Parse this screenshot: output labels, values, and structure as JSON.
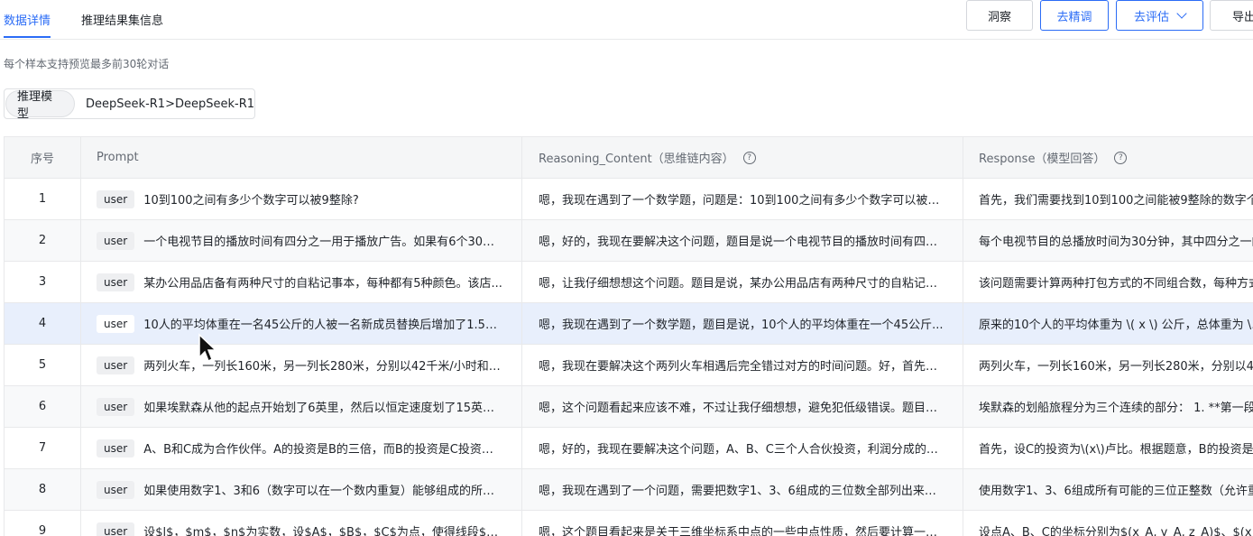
{
  "tabs": [
    {
      "label": "数据详情",
      "active": true
    },
    {
      "label": "推理结果集信息",
      "active": false
    }
  ],
  "actions": {
    "insight": "洞察",
    "tune": "去精调",
    "evaluate": "去评估",
    "export": "导出"
  },
  "hint": "每个样本支持预览最多前30轮对话",
  "model_filter": {
    "tag": "推理模型",
    "value": "DeepSeek-R1>DeepSeek-R1"
  },
  "table": {
    "headers": {
      "index": "序号",
      "prompt": "Prompt",
      "reasoning": "Reasoning_Content（思维链内容）",
      "response": "Response（模型回答）"
    },
    "rows": [
      {
        "index": "1",
        "role": "user",
        "prompt": "10到100之间有多少个数字可以被9整除?",
        "reasoning": "嗯，我现在遇到了一个数学题，问题是：10到100之间有多少个数字可以被9...",
        "response": "首先，我们需要找到10到100之间能被9整除的数字个"
      },
      {
        "index": "2",
        "role": "user",
        "prompt": "一个电视节目的播放时间有四分之一用于播放广告。如果有6个30分...",
        "reasoning": "嗯，好的，我现在要解决这个问题，题目是说一个电视节目的播放时间有四分...",
        "response": "每个电视节目的总播放时间为30分钟，其中四分之一的"
      },
      {
        "index": "3",
        "role": "user",
        "prompt": "某办公用品店备有两种尺寸的自粘记事本，每种都有5种颜色。该店...",
        "reasoning": "嗯，让我仔细想想这个问题。题目是说，某办公用品店有两种尺寸的自粘记事...",
        "response": "该问题需要计算两种打包方式的不同组合数，每种方式"
      },
      {
        "index": "4",
        "role": "user",
        "prompt": "10人的平均体重在一名45公斤的人被一名新成员替换后增加了1.5公...",
        "reasoning": "嗯，我现在遇到了一个数学题，题目是说，10个人的平均体重在一个45公斤...",
        "response": "原来的10个人的平均体重为 \\( x \\) 公斤，总体重为 \\( 1"
      },
      {
        "index": "5",
        "role": "user",
        "prompt": "两列火车，一列长160米，另一列长280米，分别以42千米/小时和3...",
        "reasoning": "嗯，我现在要解决这个两列火车相遇后完全错过对方的时间问题。好，首先题...",
        "response": "两列火车，一列长160米，另一列长280米，分别以42"
      },
      {
        "index": "6",
        "role": "user",
        "prompt": "如果埃默森从他的起点开始划了6英里，然后以恒定速度划了15英里...",
        "reasoning": "嗯，这个问题看起来应该不难，不过让我仔细想想，避免犯低级错误。题目是...",
        "response": "埃默森的划船旅程分为三个连续的部分： 1. **第一段*"
      },
      {
        "index": "7",
        "role": "user",
        "prompt": "A、B和C成为合作伙伴。A的投资是B的三倍，而B的投资是C投资的...",
        "reasoning": "嗯，好的，我现在要解决这个问题，A、B、C三个人合伙投资，利润分成的问...",
        "response": "首先，设C的投资为\\(x\\)卢比。根据题意，B的投资是C"
      },
      {
        "index": "8",
        "role": "user",
        "prompt": "如果使用数字1、3和6（数字可以在一个数内重复）能够组成的所有...",
        "reasoning": "嗯，我现在遇到了一个问题，需要把数字1、3、6组成的三位数全部列出来，...",
        "response": "使用数字1、3、6组成所有可能的三位正整数（允许重"
      },
      {
        "index": "9",
        "role": "user",
        "prompt": "设$l$，$m$，$n$为实数，设$A$，$B$，$C$为点，使得线段$B...",
        "reasoning": "嗯，这个题目看起来是关于三维坐标系中点的一些中点性质，然后要计算一个...",
        "response": "设点A、B、C的坐标分别为$(x_A, y_A, z_A)$、$(x"
      }
    ]
  },
  "selected_row": 4
}
